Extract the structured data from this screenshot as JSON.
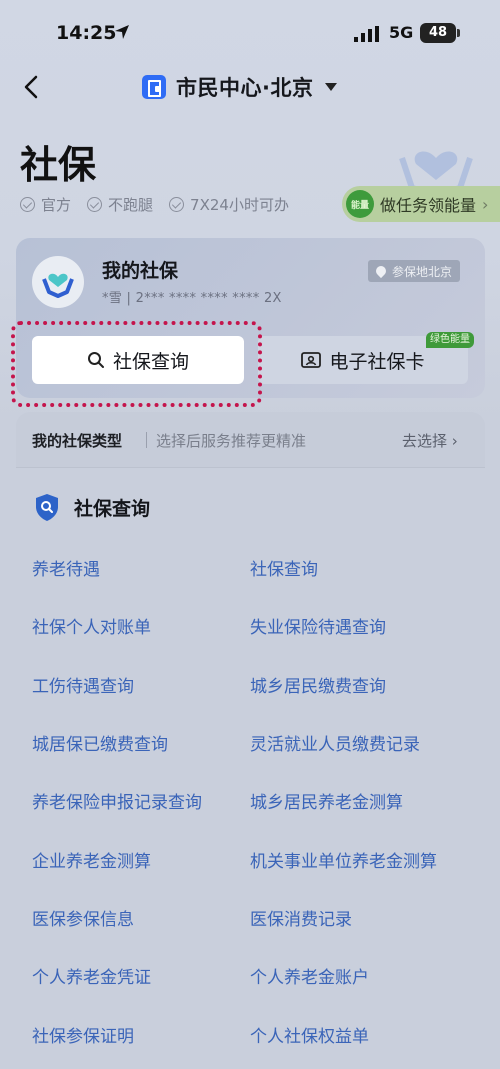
{
  "status_bar": {
    "time": "14:25",
    "network": "5G",
    "battery": "48"
  },
  "nav": {
    "title": "市民中心·北京"
  },
  "header": {
    "title": "社保",
    "tags": [
      "官方",
      "不跑腿",
      "7X24小时可办"
    ],
    "energy_badge": "能量",
    "energy_text": "做任务领能量"
  },
  "card": {
    "title": "我的社保",
    "subtitle": "*雪 | 2*** **** **** **** 2X",
    "region": "参保地北京",
    "query_button": "社保查询",
    "ecard_button": "电子社保卡",
    "green_tag": "绿色能量"
  },
  "type_row": {
    "label": "我的社保类型",
    "hint": "选择后服务推荐更精准",
    "action": "去选择"
  },
  "section": {
    "title": "社保查询",
    "items": [
      "养老待遇",
      "社保查询",
      "社保个人对账单",
      "失业保险待遇查询",
      "工伤待遇查询",
      "城乡居民缴费查询",
      "城居保已缴费查询",
      "灵活就业人员缴费记录",
      "养老保险申报记录查询",
      "城乡居民养老金测算",
      "企业养老金测算",
      "机关事业单位养老金测算",
      "医保参保信息",
      "医保消费记录",
      "个人养老金凭证",
      "个人养老金账户",
      "社保参保证明",
      "个人社保权益单"
    ]
  },
  "colors": {
    "accent": "#2f6cf5",
    "link": "#3a64b8",
    "highlight": "#c4154c",
    "energy": "#3e9b3c"
  }
}
